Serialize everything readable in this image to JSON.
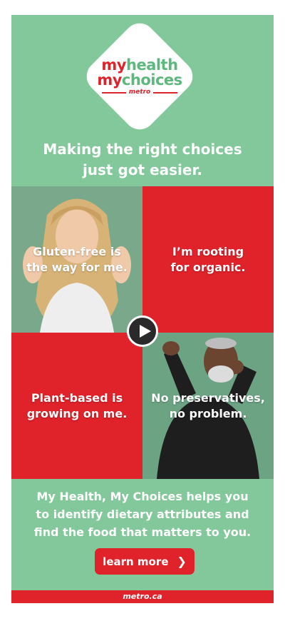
{
  "logo": {
    "line1_a": "my",
    "line1_b": "health",
    "line2_a": "my",
    "line2_b": "choices",
    "sub": "metro"
  },
  "headline": {
    "line1": "Making the right choices",
    "line2": "just got easier."
  },
  "tiles": {
    "gluten": [
      "Gluten-free is",
      "the way for me."
    ],
    "organic": [
      "I’m rooting",
      "for organic."
    ],
    "plant": [
      "Plant-based is",
      "growing on me."
    ],
    "preservatives": [
      "No preservatives,",
      "no problem."
    ]
  },
  "body": {
    "line1": "My Health, My Choices helps you",
    "line2": "to identify dietary attributes and",
    "line3": "find the food that matters to you."
  },
  "cta": {
    "label": "learn more",
    "icon": "chevron-right-icon"
  },
  "footer": {
    "text": "metro.ca"
  },
  "colors": {
    "green": "#82c89a",
    "red": "#e0222a",
    "white": "#ffffff"
  }
}
